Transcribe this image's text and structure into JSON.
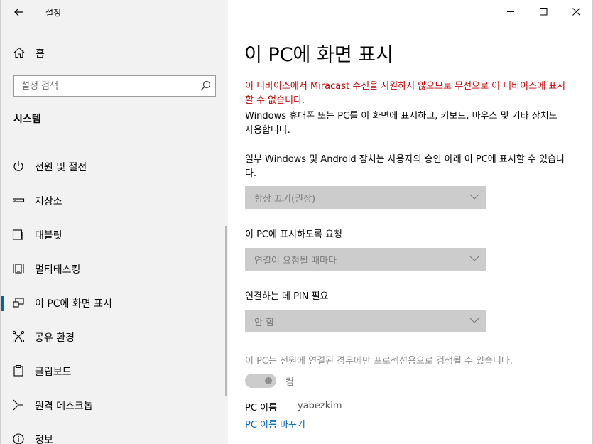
{
  "window": {
    "title": "설정",
    "controls": [
      "minimize",
      "maximize",
      "close"
    ]
  },
  "sidebar": {
    "home_label": "홈",
    "search_placeholder": "설정 검색",
    "section_title": "시스템",
    "items": [
      {
        "label": "전원 및 절전",
        "icon": "power-icon",
        "selected": false
      },
      {
        "label": "저장소",
        "icon": "storage-icon",
        "selected": false
      },
      {
        "label": "태블릿",
        "icon": "tablet-icon",
        "selected": false
      },
      {
        "label": "멀티태스킹",
        "icon": "multitasking-icon",
        "selected": false
      },
      {
        "label": "이 PC에 화면 표시",
        "icon": "projecting-icon",
        "selected": true
      },
      {
        "label": "공유 환경",
        "icon": "shared-experiences-icon",
        "selected": false
      },
      {
        "label": "클립보드",
        "icon": "clipboard-icon",
        "selected": false
      },
      {
        "label": "원격 데스크톱",
        "icon": "remote-desktop-icon",
        "selected": false
      },
      {
        "label": "정보",
        "icon": "info-icon",
        "selected": false
      }
    ]
  },
  "main": {
    "title": "이 PC에 화면 표시",
    "warning": "이 디바이스에서 Miracast 수신을 지원하지 않으므로 무선으로 이 디바이스에 표시할 수 없습니다.",
    "description": "Windows 휴대폰 또는 PC를 이 화면에 표시하고, 키보드, 마우스 및 기타 장치도 사용합니다.",
    "setting1_label": "일부 Windows 및 Android 장치는 사용자의 승인 아래 이 PC에 표시할 수 있습니다.",
    "setting1_value": "항상 끄기(권장)",
    "setting2_label": "이 PC에 표시하도록 요청",
    "setting2_value": "연결이 요청될 때마다",
    "setting3_label": "연결하는 데 PIN 필요",
    "setting3_value": "안 함",
    "power_note": "이 PC는 전원에 연결된 경우에만 프로젝션용으로 검색될 수 있습니다.",
    "toggle_label": "켬",
    "toggle_on": true,
    "pc_name_label": "PC 이름",
    "pc_name_value": "yabezkim",
    "rename_link": "PC 이름 바꾸기"
  },
  "colors": {
    "accent": "#0063b1",
    "warning": "#c50000",
    "sidebar_bg": "#f2f2f2",
    "disabled_bg": "#cccccc"
  }
}
